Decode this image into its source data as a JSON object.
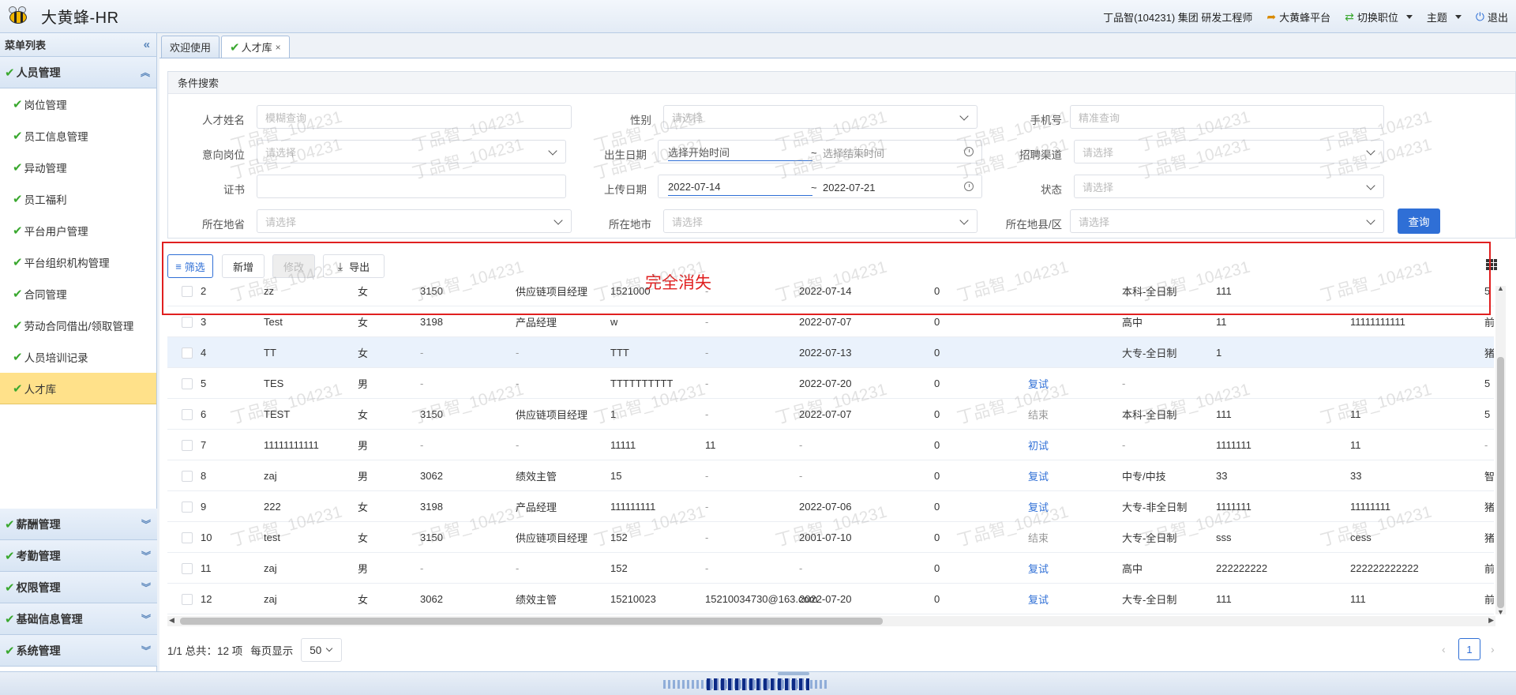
{
  "app": {
    "title": "大黄蜂-HR"
  },
  "topbar": {
    "user": "丁品智(104231) 集团 研发工程师",
    "platform": "大黄蜂平台",
    "switch_role": "切换职位",
    "theme": "主题",
    "logout": "退出"
  },
  "sidebar": {
    "header": "菜单列表",
    "collapse": "«",
    "open_group": "人员管理",
    "items": [
      {
        "label": "岗位管理"
      },
      {
        "label": "员工信息管理"
      },
      {
        "label": "异动管理"
      },
      {
        "label": "员工福利"
      },
      {
        "label": "平台用户管理"
      },
      {
        "label": "平台组织机构管理"
      },
      {
        "label": "合同管理"
      },
      {
        "label": "劳动合同借出/领取管理"
      },
      {
        "label": "人员培训记录"
      },
      {
        "label": "人才库"
      }
    ],
    "groups": [
      {
        "label": "薪酬管理"
      },
      {
        "label": "考勤管理"
      },
      {
        "label": "权限管理"
      },
      {
        "label": "基础信息管理"
      },
      {
        "label": "系统管理"
      }
    ]
  },
  "tabs": [
    {
      "label": "欢迎使用"
    },
    {
      "label": "人才库",
      "close": "×"
    }
  ],
  "search": {
    "title": "条件搜索",
    "fields": {
      "name": {
        "label": "人才姓名",
        "placeholder": "模糊查询"
      },
      "gender": {
        "label": "性别",
        "placeholder": "请选择"
      },
      "phone": {
        "label": "手机号",
        "placeholder": "精准查询"
      },
      "position": {
        "label": "意向岗位",
        "placeholder": "请选择"
      },
      "birth": {
        "label": "出生日期",
        "start": "选择开始时间",
        "sep": "~",
        "end": "选择结束时间"
      },
      "channel": {
        "label": "招聘渠道",
        "placeholder": "请选择"
      },
      "cert": {
        "label": "证书",
        "value": ""
      },
      "upload": {
        "label": "上传日期",
        "start": "2022-07-14",
        "sep": "~",
        "end": "2022-07-21"
      },
      "status": {
        "label": "状态",
        "placeholder": "请选择"
      },
      "province": {
        "label": "所在地省",
        "placeholder": "请选择"
      },
      "city": {
        "label": "所在地市",
        "placeholder": "请选择"
      },
      "county": {
        "label": "所在地县/区",
        "placeholder": "请选择"
      }
    },
    "query_button": "查询"
  },
  "toolbar": {
    "filter": "筛选",
    "add": "新增",
    "edit": "修改",
    "export": "导出"
  },
  "table": {
    "rows": [
      [
        "2",
        "zz",
        "女",
        "3150",
        "供应链项目经理",
        "1521000",
        "-",
        "2022-07-14",
        "0",
        "",
        "本科-全日制",
        "111",
        "",
        "5"
      ],
      [
        "3",
        "Test",
        "女",
        "3198",
        "产品经理",
        "w",
        "-",
        "2022-07-07",
        "0",
        "",
        "高中",
        "11",
        "11111111111",
        "前"
      ],
      [
        "4",
        "TT",
        "女",
        "-",
        "-",
        "TTT",
        "-",
        "2022-07-13",
        "0",
        "",
        "大专-全日制",
        "1",
        "",
        "猪"
      ],
      [
        "5",
        "TES",
        "男",
        "-",
        "-",
        "TTTTTTTTTT",
        "-",
        "2022-07-20",
        "0",
        "复试",
        "-",
        "",
        "",
        "5"
      ],
      [
        "6",
        "TEST",
        "女",
        "3150",
        "供应链项目经理",
        "1",
        "-",
        "2022-07-07",
        "0",
        "结束",
        "本科-全日制",
        "111",
        "11",
        "5"
      ],
      [
        "7",
        "11111111111",
        "男",
        "-",
        "-",
        "11111",
        "11",
        "-",
        "0",
        "初试",
        "-",
        "1111111",
        "11",
        "-"
      ],
      [
        "8",
        "zaj",
        "男",
        "3062",
        "绩效主管",
        "15",
        "-",
        "-",
        "0",
        "复试",
        "中专/中技",
        "33",
        "33",
        "智"
      ],
      [
        "9",
        "222",
        "女",
        "3198",
        "产品经理",
        "111111111",
        "-",
        "2022-07-06",
        "0",
        "复试",
        "大专-非全日制",
        "1111111",
        "11111111",
        "猪"
      ],
      [
        "10",
        "test",
        "女",
        "3150",
        "供应链项目经理",
        "152",
        "-",
        "2001-07-10",
        "0",
        "结束",
        "大专-全日制",
        "sss",
        "cess",
        "猪"
      ],
      [
        "11",
        "zaj",
        "男",
        "-",
        "-",
        "152",
        "-",
        "-",
        "0",
        "复试",
        "高中",
        "222222222",
        "222222222222",
        "前"
      ],
      [
        "12",
        "zaj",
        "女",
        "3062",
        "绩效主管",
        "15210023",
        "15210034730@163.com",
        "2022-07-20",
        "0",
        "复试",
        "大专-全日制",
        "111",
        "111",
        "前"
      ]
    ]
  },
  "pagination": {
    "summary": "1/1 总共：12 项",
    "per_page_label": "每页显示",
    "per_page": "50",
    "current": "1",
    "prev": "‹",
    "next": "›"
  },
  "annotation": {
    "text": "完全消失"
  },
  "watermark": "丁品智_104231",
  "colors": {
    "accent": "#2f6fd6",
    "annotation": "#e02020",
    "active_menu": "#ffe18a",
    "check": "#3aa82f"
  }
}
